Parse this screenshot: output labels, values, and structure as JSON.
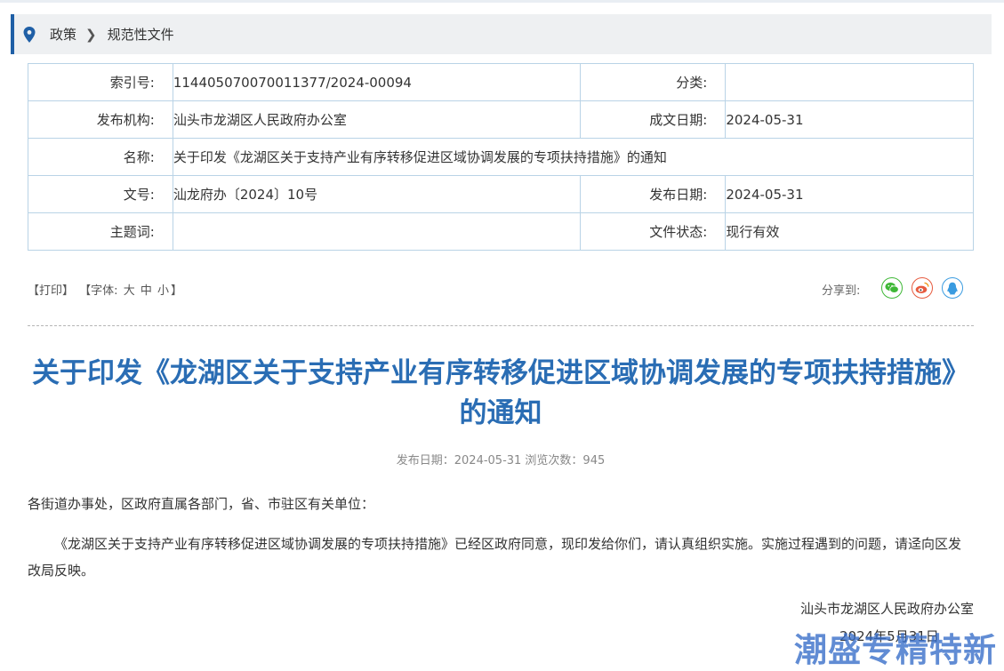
{
  "breadcrumb": {
    "item1": "政策",
    "item2": "规范性文件"
  },
  "meta": {
    "index_label": "索引号:",
    "index_value": "114405070070011377/2024-00094",
    "category_label": "分类:",
    "category_value": "",
    "org_label": "发布机构:",
    "org_value": "汕头市龙湖区人民政府办公室",
    "created_label": "成文日期:",
    "created_value": "2024-05-31",
    "name_label": "名称:",
    "name_value": "关于印发《龙湖区关于支持产业有序转移促进区域协调发展的专项扶持措施》的通知",
    "docno_label": "文号:",
    "docno_value": "汕龙府办〔2024〕10号",
    "pubdate_label": "发布日期:",
    "pubdate_value": "2024-05-31",
    "keywords_label": "主题词:",
    "keywords_value": "",
    "status_label": "文件状态:",
    "status_value": "现行有效"
  },
  "tools": {
    "print": "【打印】",
    "font_prefix": "【字体:",
    "font_large": "大",
    "font_medium": "中",
    "font_small": "小",
    "font_suffix": "】"
  },
  "share": {
    "label": "分享到:",
    "icons": [
      "wechat-icon",
      "weibo-icon",
      "qq-icon"
    ]
  },
  "article": {
    "title": "关于印发《龙湖区关于支持产业有序转移促进区域协调发展的专项扶持措施》的通知",
    "subline": "发布日期：2024-05-31  浏览次数：945",
    "salutation": "各街道办事处，区政府直属各部门，省、市驻区有关单位：",
    "body": "《龙湖区关于支持产业有序转移促进区域协调发展的专项扶持措施》已经区政府同意，现印发给你们，请认真组织实施。实施过程遇到的问题，请迳向区发改局反映。",
    "signature": "汕头市龙湖区人民政府办公室",
    "date": "2024年5月31日"
  },
  "watermark": "潮盛专精特新",
  "colors": {
    "accent": "#1f5fa6",
    "title": "#2a6db4",
    "border": "#b9d3e6",
    "wechat": "#3fb837",
    "weibo": "#e65a3e",
    "qq": "#3a9be0"
  }
}
